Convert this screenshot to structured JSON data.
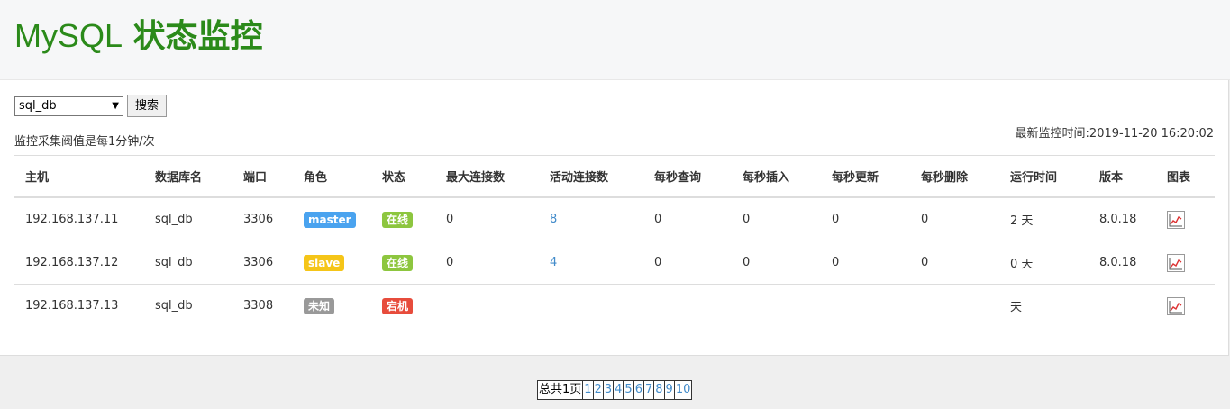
{
  "header": {
    "title_en": "MySQL",
    "title_cn": "状态监控"
  },
  "controls": {
    "db_select_value": "sql_db",
    "search_label": "搜索"
  },
  "frequency_text": "监控采集阀值是每1分钟/次",
  "last_time_text": "最新监控时间:2019-11-20 16:20:02",
  "table": {
    "headers": [
      "主机",
      "数据库名",
      "端口",
      "角色",
      "状态",
      "最大连接数",
      "活动连接数",
      "每秒查询",
      "每秒插入",
      "每秒更新",
      "每秒删除",
      "运行时间",
      "版本",
      "图表"
    ],
    "rows": [
      {
        "host": "192.168.137.11",
        "db": "sql_db",
        "port": "3306",
        "role": "master",
        "role_color": "#4aa3ef",
        "status": "在线",
        "status_color": "#8dc63f",
        "max_conn": "0",
        "active_conn": "8",
        "qps": "0",
        "ips": "0",
        "ups": "0",
        "dps": "0",
        "uptime": "2 天",
        "version": "8.0.18"
      },
      {
        "host": "192.168.137.12",
        "db": "sql_db",
        "port": "3306",
        "role": "slave",
        "role_color": "#f5c518",
        "status": "在线",
        "status_color": "#8dc63f",
        "max_conn": "0",
        "active_conn": "4",
        "qps": "0",
        "ips": "0",
        "ups": "0",
        "dps": "0",
        "uptime": "0 天",
        "version": "8.0.18"
      },
      {
        "host": "192.168.137.13",
        "db": "sql_db",
        "port": "3308",
        "role": "未知",
        "role_color": "#999999",
        "status": "宕机",
        "status_color": "#e74c3c",
        "max_conn": "",
        "active_conn": "",
        "qps": "",
        "ips": "",
        "ups": "",
        "dps": "",
        "uptime": "天",
        "version": ""
      }
    ]
  },
  "pager": {
    "total": "总共1页",
    "pages": [
      "1",
      "2",
      "3",
      "4",
      "5",
      "6",
      "7",
      "8",
      "9",
      "10"
    ]
  }
}
